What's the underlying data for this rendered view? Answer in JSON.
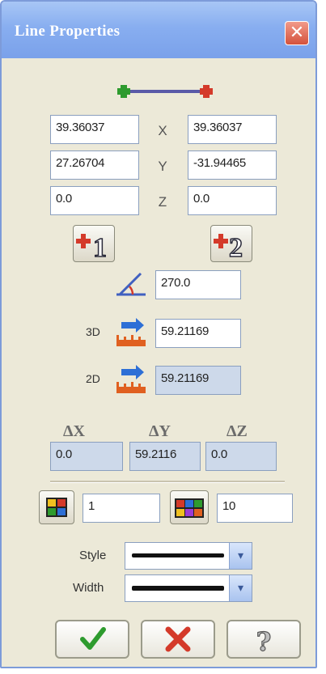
{
  "window": {
    "title": "Line Properties",
    "close_glyph": "✕"
  },
  "points": {
    "axes": [
      "X",
      "Y",
      "Z"
    ],
    "start": {
      "x": "39.36037",
      "y": "27.26704",
      "z": "0.0"
    },
    "end": {
      "x": "39.36037",
      "y": "-31.94465",
      "z": "0.0"
    },
    "start_button_label": "1",
    "end_button_label": "2"
  },
  "angle": {
    "value": "270.0"
  },
  "length": {
    "label_3d": "3D",
    "value_3d": "59.21169",
    "label_2d": "2D",
    "value_2d": "59.21169"
  },
  "deltas": {
    "labels": [
      "ΔX",
      "ΔY",
      "ΔZ"
    ],
    "values": [
      "0.0",
      "59.2116",
      "0.0"
    ]
  },
  "layers": {
    "value_1": "1",
    "value_2": "10"
  },
  "style": {
    "style_label": "Style",
    "width_label": "Width",
    "dropdown_glyph": "▾"
  },
  "buttons": {
    "ok_glyph": "✔",
    "cancel_glyph": "✖",
    "help_glyph": "?"
  },
  "colors": {
    "titlebar": "#7aa1ea",
    "start_point": "#2e9b2e",
    "end_point": "#d43a2a",
    "line": "#5a5aa8"
  }
}
